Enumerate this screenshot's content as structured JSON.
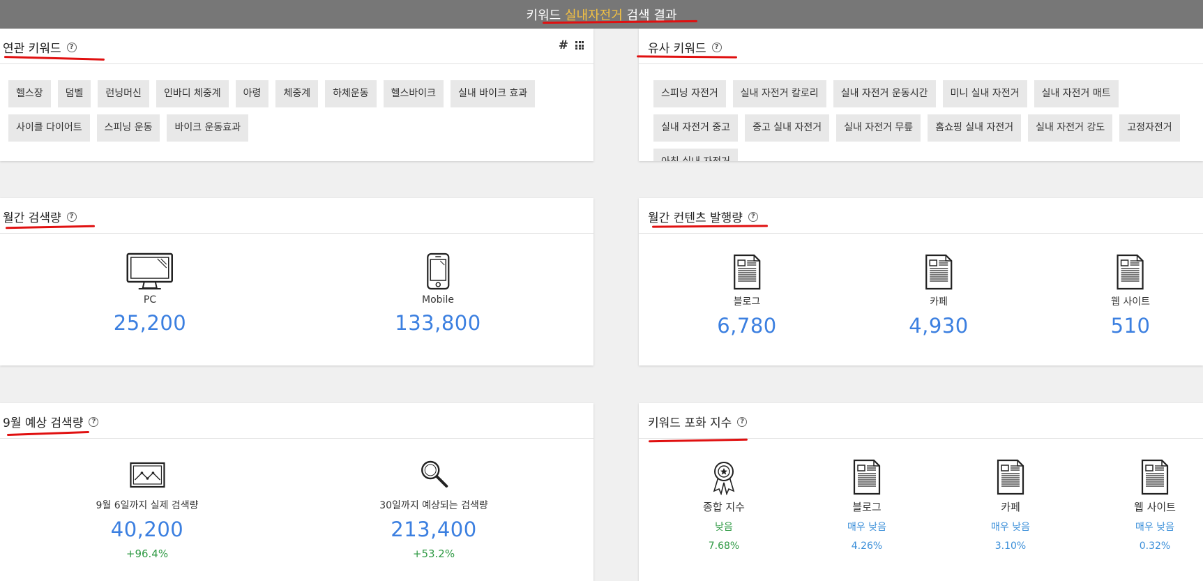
{
  "header": {
    "title_prefix": "키워드 ",
    "keyword": "실내자전거",
    "title_suffix": " 검색 결과"
  },
  "related": {
    "title": "연관 키워드",
    "help": "?",
    "hash_icon": "#",
    "tags": [
      "헬스장",
      "덤벨",
      "런닝머신",
      "인바디 체중계",
      "아령",
      "체중계",
      "하체운동",
      "헬스바이크",
      "실내 바이크 효과",
      "사이클 다이어트",
      "스피닝 운동",
      "바이크 운동효과"
    ]
  },
  "similar": {
    "title": "유사 키워드",
    "help": "?",
    "tags": [
      "스피닝 자전거",
      "실내 자전거 칼로리",
      "실내 자전거 운동시간",
      "미니 실내 자전거",
      "실내 자전거 매트",
      "실내 자전거 중고",
      "중고 실내 자전거",
      "실내 자전거 무릎",
      "홈쇼핑 실내 자전거",
      "실내 자전거 강도",
      "고정자전거",
      "아침 실내 자전거"
    ]
  },
  "monthly": {
    "title": "월간 검색량",
    "help": "?",
    "pc": {
      "label": "PC",
      "value": "25,200",
      "icon": "monitor-icon"
    },
    "mobile": {
      "label": "Mobile",
      "value": "133,800",
      "icon": "smartphone-icon"
    }
  },
  "content": {
    "title": "월간 컨텐츠 발행량",
    "help": "?",
    "blog": {
      "label": "블로그",
      "value": "6,780",
      "icon": "document-icon"
    },
    "cafe": {
      "label": "카페",
      "value": "4,930",
      "icon": "document-icon"
    },
    "web": {
      "label": "웹 사이트",
      "value": "510",
      "icon": "document-icon"
    }
  },
  "forecast": {
    "title": "9월 예상 검색량",
    "help": "?",
    "actual": {
      "label": "9월 6일까지 실제 검색량",
      "value": "40,200",
      "change": "+96.4%",
      "icon": "chart-image-icon"
    },
    "expected": {
      "label": "30일까지 예상되는 검색량",
      "value": "213,400",
      "change": "+53.2%",
      "icon": "magnifier-icon"
    }
  },
  "saturation": {
    "title": "키워드 포화 지수",
    "help": "?",
    "colors": {
      "green": "#2f9a44",
      "blue": "#3b8fd9"
    },
    "total": {
      "label": "종합 지수",
      "level": "낮음",
      "pct": "7.68%",
      "icon": "award-ribbon-icon"
    },
    "blog": {
      "label": "블로그",
      "level": "매우 낮음",
      "pct": "4.26%",
      "icon": "document-icon"
    },
    "cafe": {
      "label": "카페",
      "level": "매우 낮음",
      "pct": "3.10%",
      "icon": "document-icon"
    },
    "web": {
      "label": "웹 사이트",
      "level": "매우 낮음",
      "pct": "0.32%",
      "icon": "document-icon"
    }
  }
}
